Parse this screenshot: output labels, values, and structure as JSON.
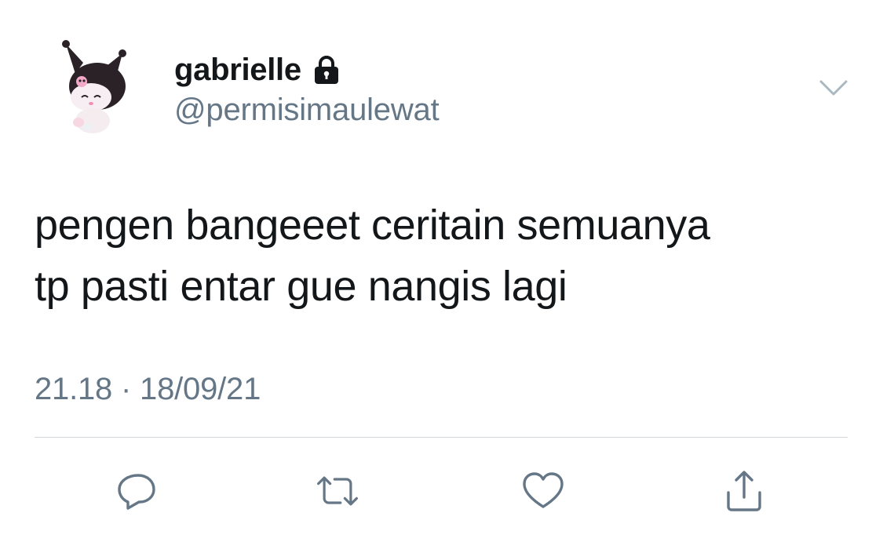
{
  "tweet": {
    "display_name": "gabrielle",
    "handle": "@permisimaulewat",
    "protected": true,
    "text_lines": [
      "pengen bangeeet ceritain semuanya",
      "tp pasti entar gue nangis lagi"
    ],
    "timestamp": "21.18 · 18/09/21"
  },
  "icons": {
    "avatar": "kuromi-avatar",
    "lock": "lock-icon",
    "more": "chevron-down-icon",
    "reply": "reply-icon",
    "retweet": "retweet-icon",
    "like": "heart-icon",
    "share": "share-icon"
  },
  "colors": {
    "text_primary": "#14171a",
    "text_secondary": "#657786",
    "icon_gray": "#657786",
    "divider": "#d3d8dc"
  }
}
